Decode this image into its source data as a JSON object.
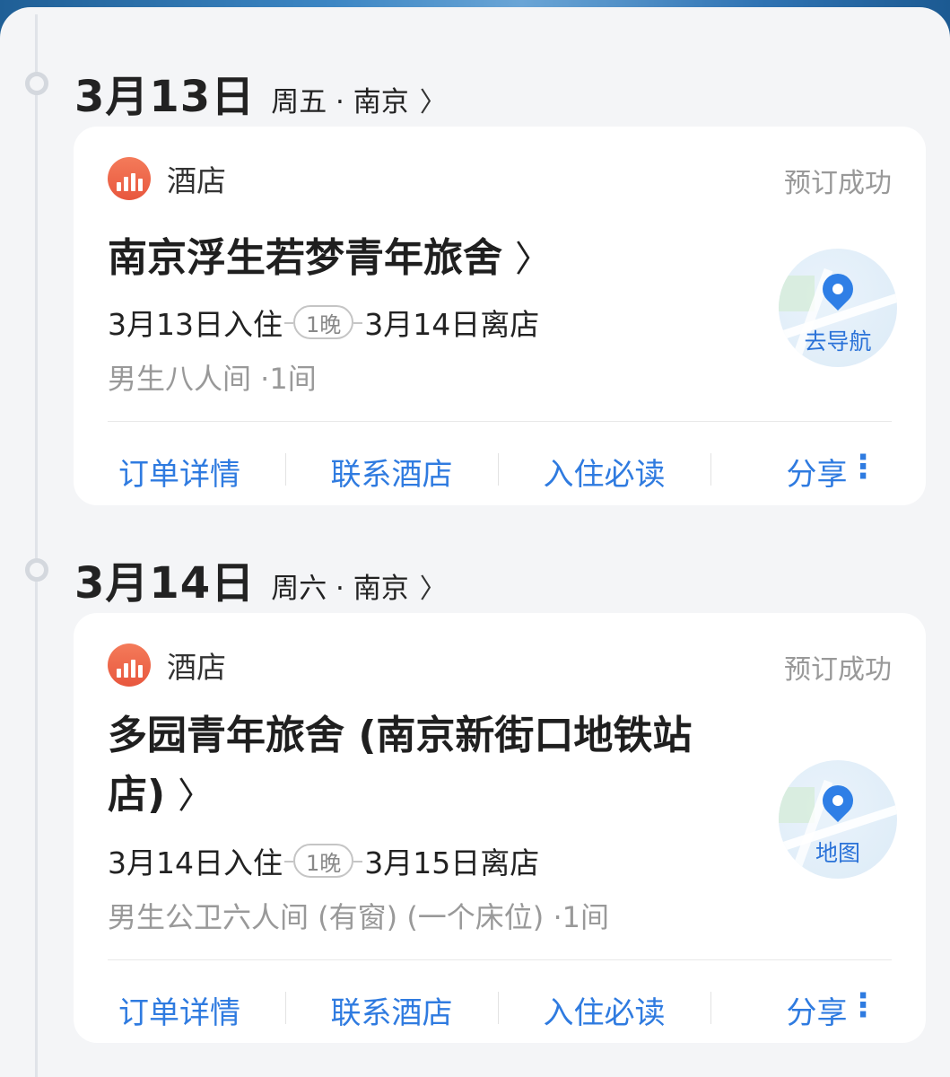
{
  "days": [
    {
      "date": "3月13日",
      "sub": "周五 · 南京",
      "card": {
        "type": "酒店",
        "status": "预订成功",
        "hotel_name": "南京浮生若梦青年旅舍",
        "checkin": "3月13日入住",
        "nights": "1晚",
        "checkout": "3月14日离店",
        "room": "男生八人间 ·1间",
        "nav_label": "去导航",
        "actions": [
          "订单详情",
          "联系酒店",
          "入住必读",
          "分享"
        ]
      }
    },
    {
      "date": "3月14日",
      "sub": "周六 · 南京",
      "card": {
        "type": "酒店",
        "status": "预订成功",
        "hotel_name": "多园青年旅舍 (南京新街口地铁站店)",
        "checkin": "3月14日入住",
        "nights": "1晚",
        "checkout": "3月15日离店",
        "room": "男生公卫六人间 (有窗) (一个床位) ·1间",
        "nav_label": "地图",
        "actions": [
          "订单详情",
          "联系酒店",
          "入住必读",
          "分享"
        ]
      }
    }
  ],
  "icons": {
    "hotel": "hotel-icon",
    "chevron": "chevron-right-icon",
    "pin": "location-pin-icon",
    "more": "more-vertical-icon"
  },
  "colors": {
    "accent": "#2f7be0",
    "hotel_icon": "#ef6a4c",
    "status_text": "#999999"
  }
}
